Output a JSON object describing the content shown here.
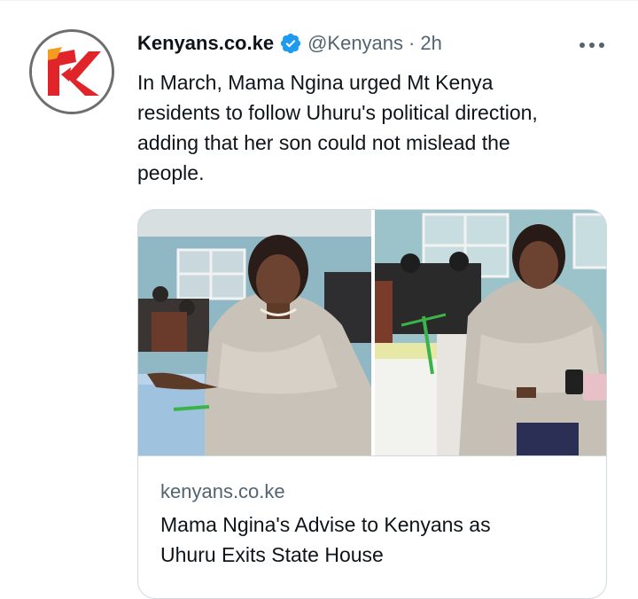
{
  "tweet": {
    "author": {
      "display_name": "Kenyans.co.ke",
      "handle": "@Kenyans",
      "verified": true,
      "avatar_icon": "kenyans-k-logo-icon"
    },
    "separator": "·",
    "time": "2h",
    "more_icon": "more-dots-icon",
    "text_lines": [
      "In March, Mama Ngina urged Mt Kenya",
      "residents to follow Uhuru's political direction,",
      "adding that her son could not mislead the",
      "people."
    ],
    "card": {
      "domain": "kenyans.co.ke",
      "title_lines": [
        "Mama Ngina's Advise to Kenyans as",
        "Uhuru Exits State House"
      ]
    }
  },
  "colors": {
    "text_primary": "#0f1419",
    "text_secondary": "#536471",
    "verified_blue": "#1d9bf0",
    "logo_red": "#e0242a",
    "logo_orange": "#f39c1f",
    "border": "#cfd9de"
  }
}
